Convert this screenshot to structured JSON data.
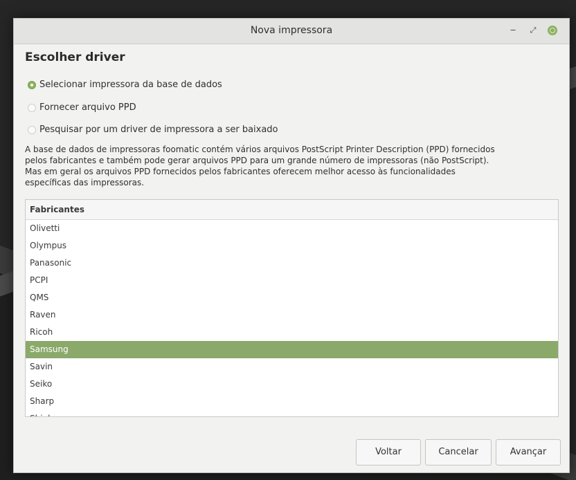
{
  "window": {
    "title": "Nova impressora",
    "controls": {
      "minimize": "‒",
      "maximize": "⤢"
    }
  },
  "page": {
    "heading": "Escolher driver",
    "options": [
      {
        "label": "Selecionar impressora da base de dados",
        "selected": true
      },
      {
        "label": "Fornecer arquivo PPD",
        "selected": false
      },
      {
        "label": "Pesquisar por um driver de impressora a ser baixado",
        "selected": false
      }
    ],
    "description": [
      "A base de dados de impressoras foomatic contém vários arquivos PostScript Printer Description (PPD) fornecidos",
      "pelos fabricantes e também pode gerar arquivos PPD para um grande número de impressoras (não PostScript).",
      "Mas em geral os arquivos PPD fornecidos pelos fabricantes oferecem melhor acesso às funcionalidades",
      "específicas das impressoras."
    ]
  },
  "manufacturers": {
    "header": "Fabricantes",
    "items": [
      "Olivetti",
      "Olympus",
      "Panasonic",
      "PCPI",
      "QMS",
      "Raven",
      "Ricoh",
      "Samsung",
      "Savin",
      "Seiko",
      "Sharp",
      "Shinko"
    ],
    "selected": "Samsung"
  },
  "buttons": {
    "back": "Voltar",
    "cancel": "Cancelar",
    "next": "Avançar"
  },
  "colors": {
    "accent": "#8ab35b",
    "selection": "#8ba96a"
  }
}
